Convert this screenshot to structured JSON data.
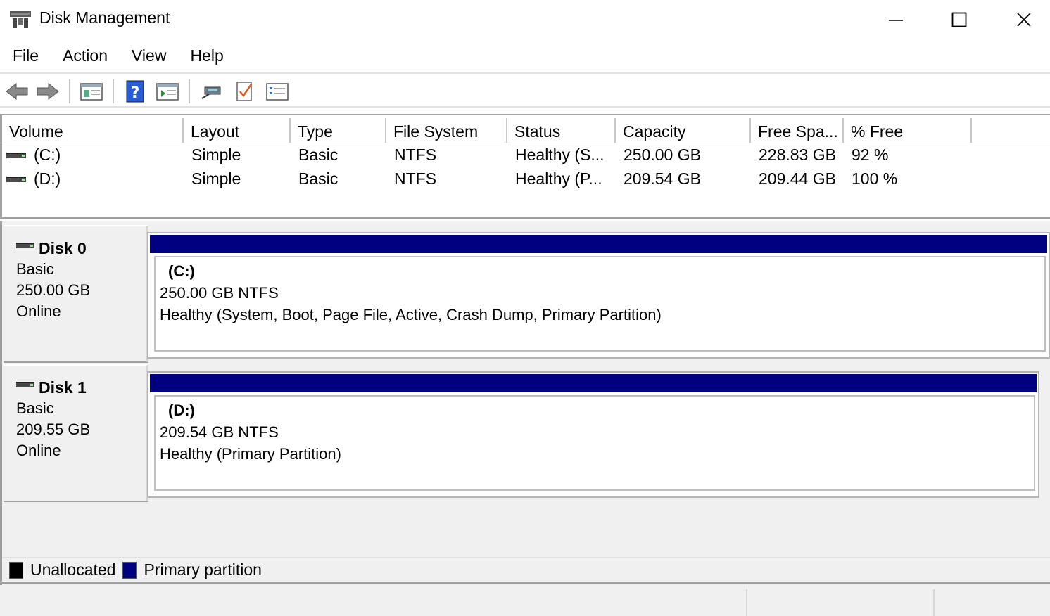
{
  "window": {
    "title": "Disk Management"
  },
  "menu": [
    "File",
    "Action",
    "View",
    "Help"
  ],
  "toolbar": {
    "icons": [
      "back-arrow-icon",
      "forward-arrow-icon",
      "properties-icon",
      "help-icon",
      "show-hide-console-tree-icon",
      "connect-icon",
      "check-disk-icon",
      "settings-list-icon"
    ]
  },
  "volume_list": {
    "columns": [
      "Volume",
      "Layout",
      "Type",
      "File System",
      "Status",
      "Capacity",
      "Free Spa...",
      "% Free"
    ],
    "rows": [
      {
        "volume": "(C:)",
        "layout": "Simple",
        "type": "Basic",
        "fs": "NTFS",
        "status": "Healthy (S...",
        "capacity": "250.00 GB",
        "free": "228.83 GB",
        "pct": "92 %"
      },
      {
        "volume": "(D:)",
        "layout": "Simple",
        "type": "Basic",
        "fs": "NTFS",
        "status": "Healthy (P...",
        "capacity": "209.54 GB",
        "free": "209.44 GB",
        "pct": "100 %"
      }
    ]
  },
  "disks": [
    {
      "name": "Disk 0",
      "type": "Basic",
      "size": "250.00 GB",
      "state": "Online",
      "partition": {
        "name": "(C:)",
        "size_fs": "250.00 GB NTFS",
        "status": "Healthy (System, Boot, Page File, Active, Crash Dump, Primary Partition)"
      }
    },
    {
      "name": "Disk 1",
      "type": "Basic",
      "size": "209.55 GB",
      "state": "Online",
      "partition": {
        "name": "(D:)",
        "size_fs": "209.54 GB NTFS",
        "status": "Healthy (Primary Partition)"
      }
    }
  ],
  "legend": [
    {
      "label": "Unallocated",
      "color": "#000000"
    },
    {
      "label": "Primary partition",
      "color": "#000080"
    }
  ]
}
